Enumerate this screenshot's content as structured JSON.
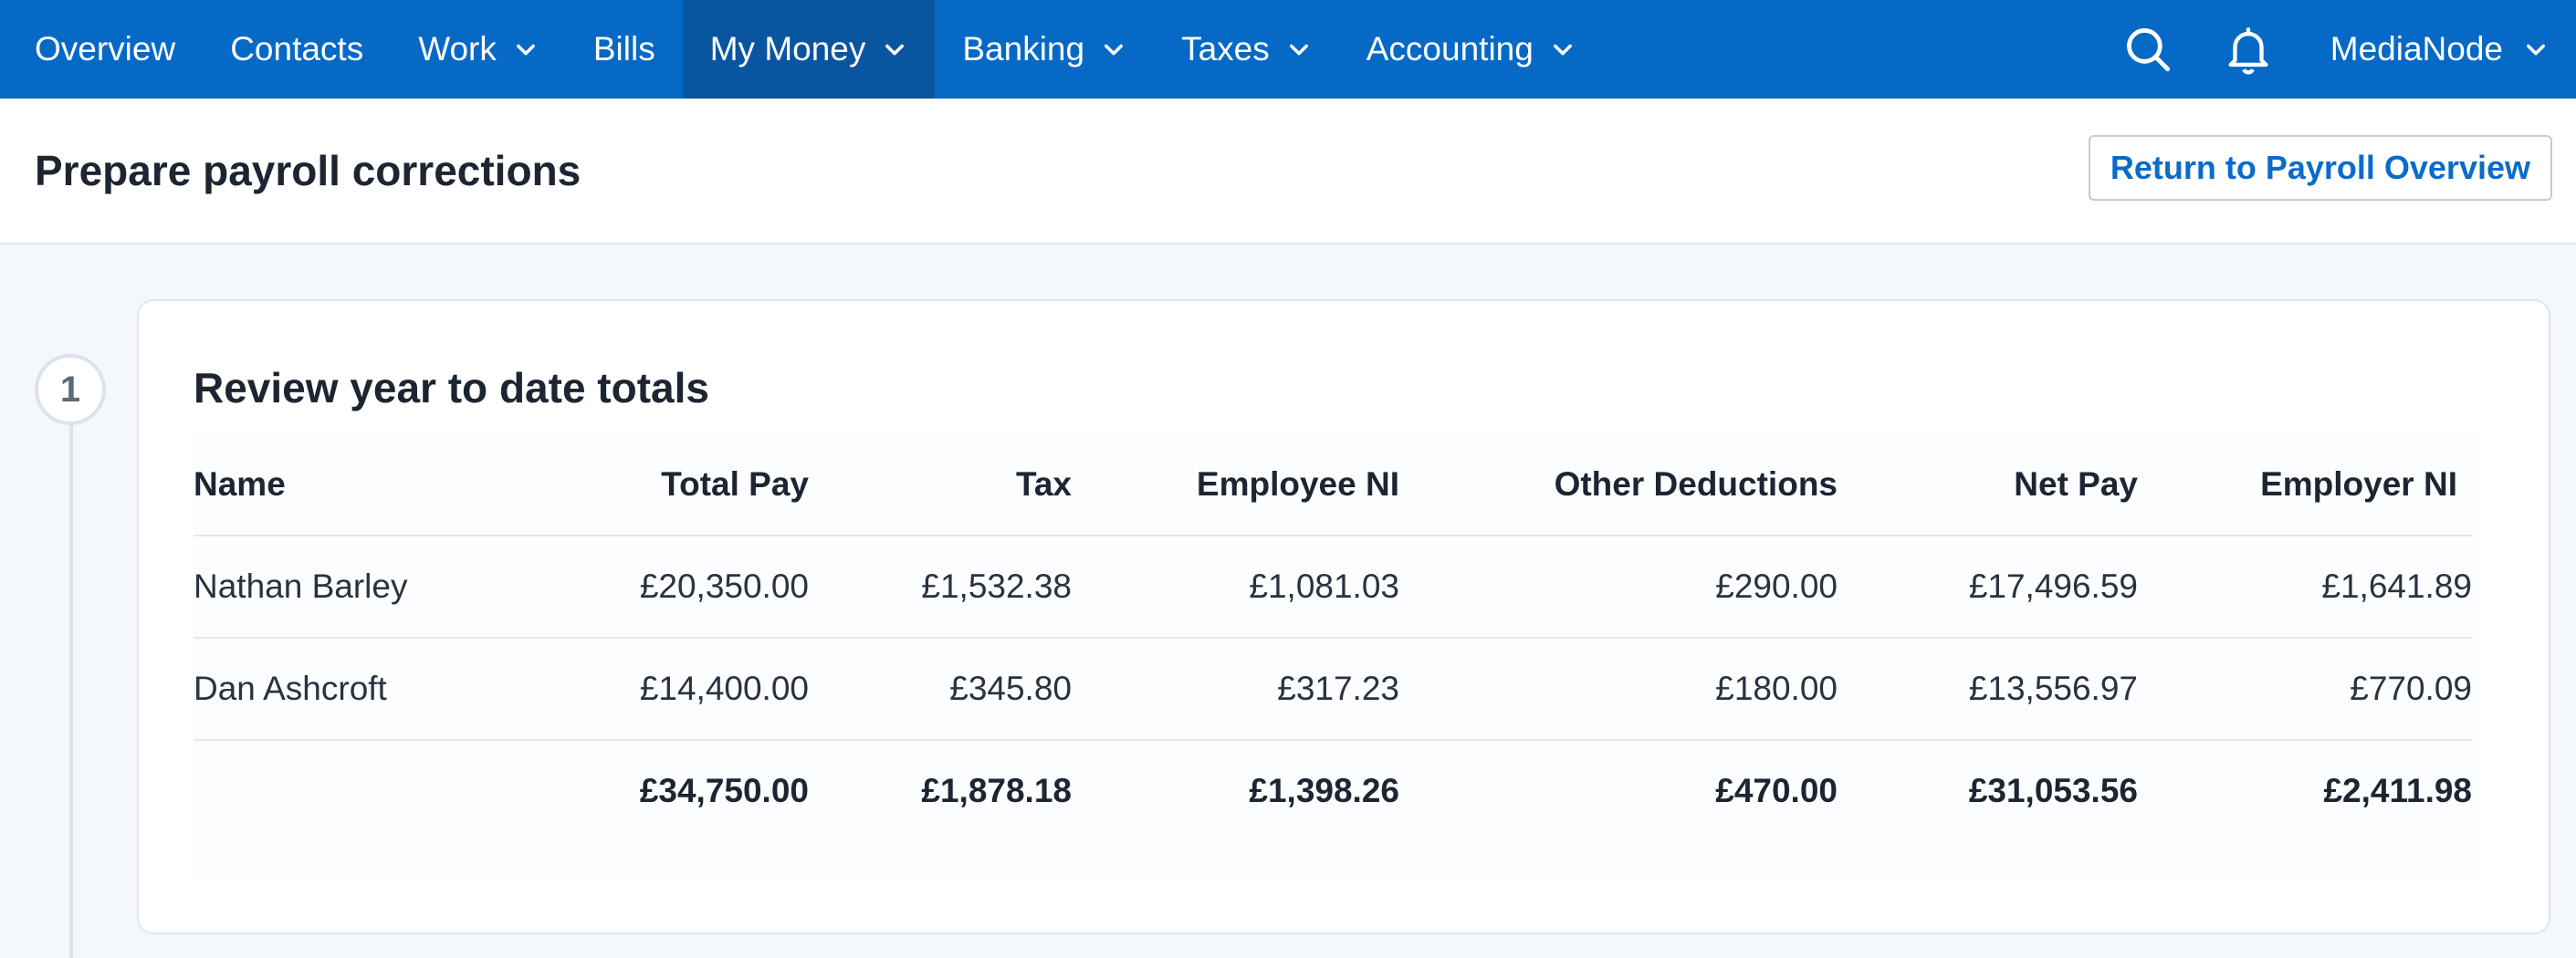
{
  "nav": {
    "items": [
      {
        "label": "Overview",
        "dropdown": false,
        "active": false
      },
      {
        "label": "Contacts",
        "dropdown": false,
        "active": false
      },
      {
        "label": "Work",
        "dropdown": true,
        "active": false
      },
      {
        "label": "Bills",
        "dropdown": false,
        "active": false
      },
      {
        "label": "My Money",
        "dropdown": true,
        "active": true
      },
      {
        "label": "Banking",
        "dropdown": true,
        "active": false
      },
      {
        "label": "Taxes",
        "dropdown": true,
        "active": false
      },
      {
        "label": "Accounting",
        "dropdown": true,
        "active": false
      }
    ],
    "org_name": "MediaNode",
    "icons": [
      "search-icon",
      "bell-icon"
    ]
  },
  "header": {
    "title": "Prepare payroll corrections",
    "return_button": "Return to Payroll Overview"
  },
  "step": {
    "number": "1",
    "title": "Review year to date totals"
  },
  "table": {
    "columns": [
      "Name",
      "Total Pay",
      "Tax",
      "Employee NI",
      "Other Deductions",
      "Net Pay",
      "Employer NI"
    ],
    "rows": [
      [
        "Nathan Barley",
        "£20,350.00",
        "£1,532.38",
        "£1,081.03",
        "£290.00",
        "£17,496.59",
        "£1,641.89"
      ],
      [
        "Dan Ashcroft",
        "£14,400.00",
        "£345.80",
        "£317.23",
        "£180.00",
        "£13,556.97",
        "£770.09"
      ]
    ],
    "totals": [
      "",
      "£34,750.00",
      "£1,878.18",
      "£1,398.26",
      "£470.00",
      "£31,053.56",
      "£2,411.98"
    ]
  },
  "colors": {
    "nav_bg": "#0669c6",
    "nav_active_bg": "#0a559f",
    "link_blue": "#0a6cc9",
    "page_bg": "#f4f7fb"
  }
}
